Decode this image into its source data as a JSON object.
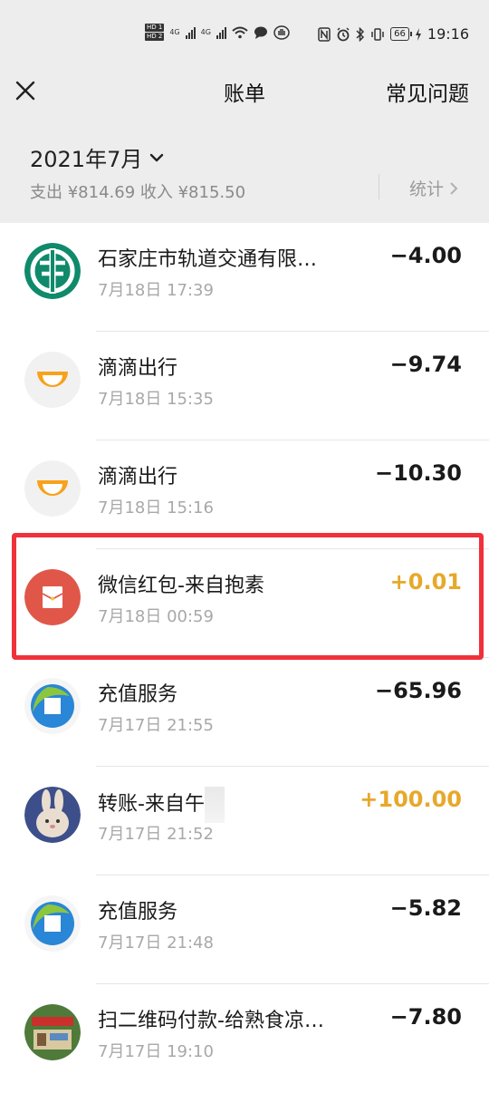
{
  "status_bar": {
    "hd1": "HD 1",
    "hd2": "HD 2",
    "net1": "4G",
    "net2": "4G",
    "battery": "66",
    "time": "19:16"
  },
  "nav": {
    "title": "账单",
    "faq": "常见问题"
  },
  "summary": {
    "month": "2021年7月",
    "totals": "支出 ¥814.69 收入 ¥815.50",
    "stats_label": "统计"
  },
  "transactions": [
    {
      "title": "石家庄市轨道交通有限…",
      "time": "7月18日 17:39",
      "amount": "−4.00",
      "icon": "abc-bank-icon"
    },
    {
      "title": "滴滴出行",
      "time": "7月18日 15:35",
      "amount": "−9.74",
      "icon": "didi-icon"
    },
    {
      "title": "滴滴出行",
      "time": "7月18日 15:16",
      "amount": "−10.30",
      "icon": "didi-icon"
    },
    {
      "title": "微信红包-来自抱素",
      "time": "7月18日 00:59",
      "amount": "+0.01",
      "icon": "red-packet-icon"
    },
    {
      "title": "充值服务",
      "time": "7月17日 21:55",
      "amount": "−65.96",
      "icon": "recharge-icon"
    },
    {
      "title": "转账-来自午",
      "time": "7月17日 21:52",
      "amount": "+100.00",
      "icon": "rabbit-avatar-icon"
    },
    {
      "title": "充值服务",
      "time": "7月17日 21:48",
      "amount": "−5.82",
      "icon": "recharge-icon"
    },
    {
      "title": "扫二维码付款-给熟食凉…",
      "time": "7月17日 19:10",
      "amount": "−7.80",
      "icon": "shop-photo-icon"
    }
  ],
  "colors": {
    "income": "#e7a82a",
    "highlight": "#f0313a",
    "header_bg": "#ededed"
  }
}
